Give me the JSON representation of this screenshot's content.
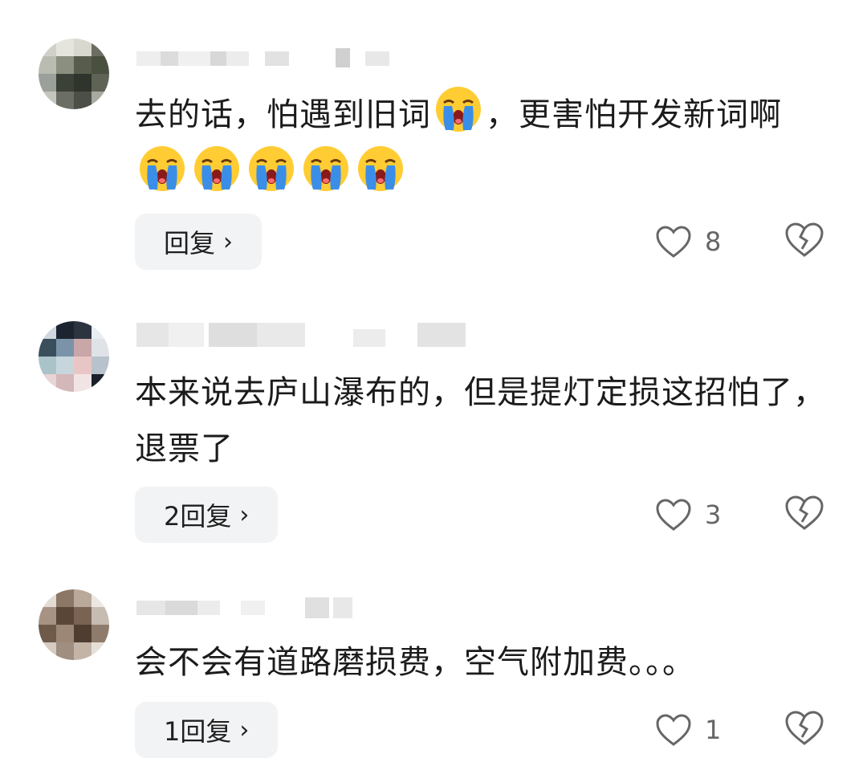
{
  "comments": [
    {
      "text_parts": [
        "去的话，怕遇到旧词",
        "，更害怕开发新词啊"
      ],
      "emojis_inline": [
        "crying-face-icon"
      ],
      "emojis_trailing": [
        "crying-face-icon",
        "crying-face-icon",
        "crying-face-icon",
        "crying-face-icon"
      ],
      "reply_label": "回复",
      "likes": "8"
    },
    {
      "text": "本来说去庐山瀑布的，但是提灯定损这招怕了，退票了",
      "reply_label": "2回复",
      "likes": "3"
    },
    {
      "text": "会不会有道路磨损费，空气附加费。。。",
      "reply_label": "1回复",
      "likes": "1"
    }
  ],
  "icons": {
    "like": "heart-outline-icon",
    "dislike": "broken-heart-icon",
    "reply_chevron": "chevron-right-icon"
  },
  "colors": {
    "reply_bg": "#f2f3f5",
    "text": "#1b1b1b",
    "count": "#666666",
    "emoji_face": "#ffcc33",
    "tear": "#3b8ee8"
  }
}
